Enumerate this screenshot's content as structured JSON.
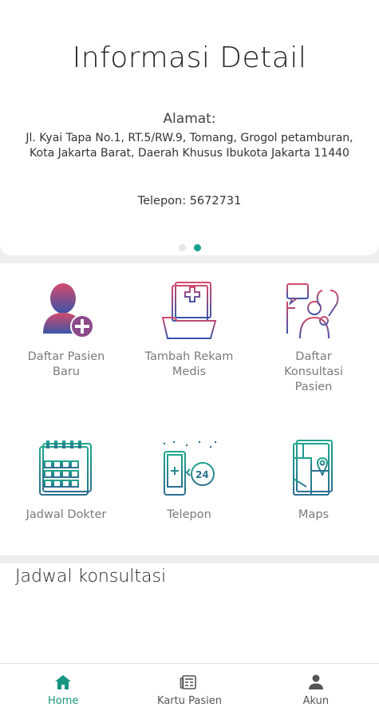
{
  "info": {
    "title": "Informasi Detail",
    "address_label": "Alamat:",
    "address_line1": "Jl. Kyai Tapa No.1, RT.5/RW.9, Tomang, Grogol petamburan,",
    "address_line2": "Kota Jakarta Barat, Daerah Khusus Ibukota Jakarta 11440",
    "phone": "Telepon: 5672731",
    "carousel_active_index": 1,
    "carousel_count": 2
  },
  "menu": [
    {
      "label": "Daftar Pasien Baru",
      "icon": "add-user-icon"
    },
    {
      "label": "Tambah Rekam Medis",
      "icon": "medical-folder-icon"
    },
    {
      "label": "Daftar Konsultasi Pasien",
      "icon": "doctor-consult-icon"
    },
    {
      "label": "Jadwal Dokter",
      "icon": "calendar-icon"
    },
    {
      "label": "Telepon",
      "icon": "phone-24-icon"
    },
    {
      "label": "Maps",
      "icon": "map-pin-icon"
    }
  ],
  "section": {
    "jadwal_title": "Jadwal konsultasi"
  },
  "nav": {
    "home": "Home",
    "kartu": "Kartu Pasien",
    "akun": "Akun",
    "active": "home"
  },
  "colors": {
    "accent": "#17a091",
    "teal": "#16957f",
    "purple": "#7a4f9a",
    "magenta": "#d24a6e"
  }
}
